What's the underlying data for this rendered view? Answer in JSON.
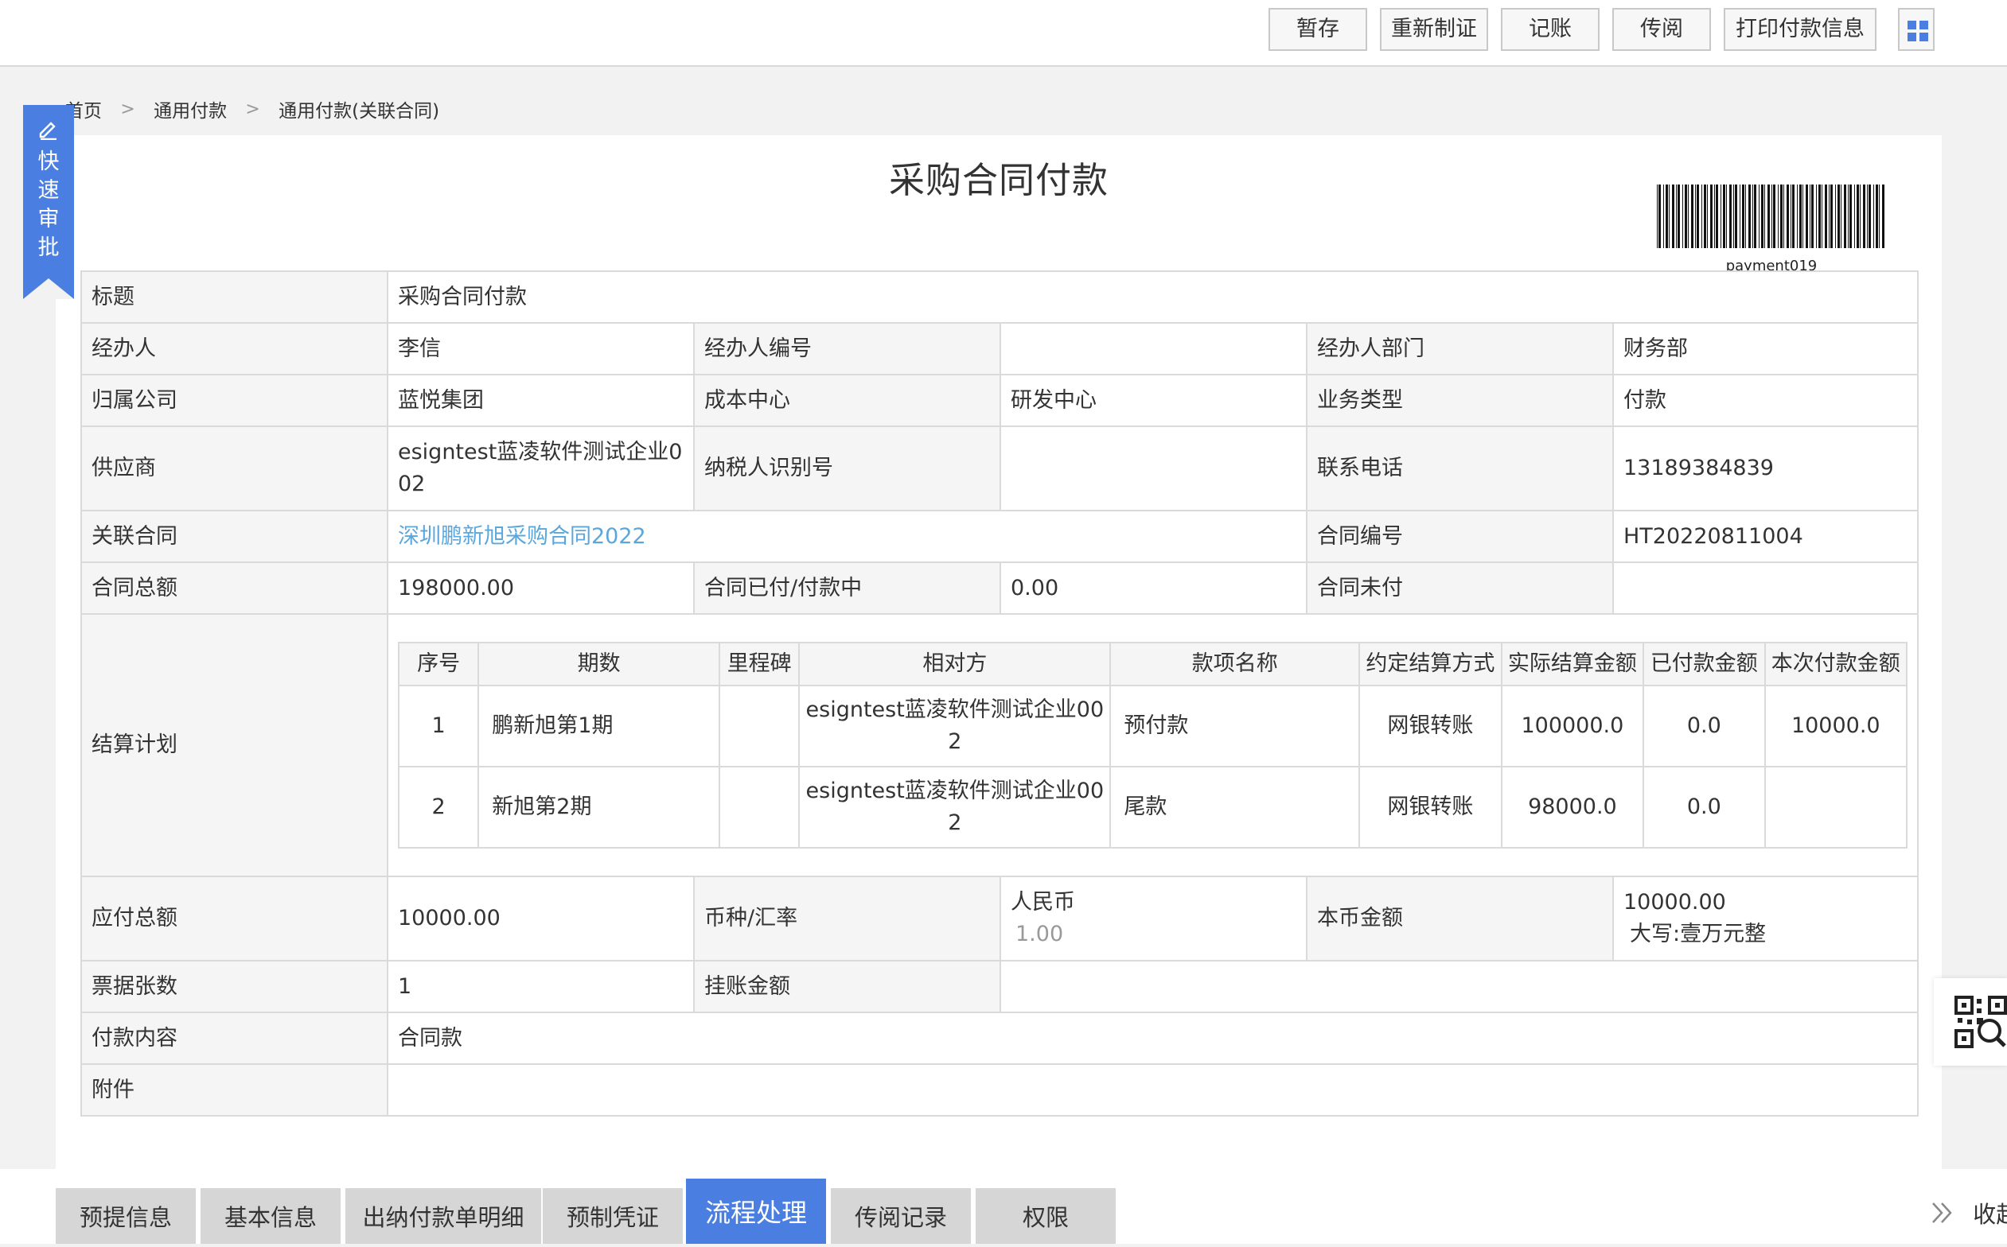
{
  "toolbar": {
    "buttons": [
      "暂存",
      "重新制证",
      "记账",
      "传阅",
      "打印付款信息"
    ],
    "grid_icon": "grid-icon"
  },
  "breadcrumb": [
    "首页",
    "通用付款",
    "通用付款(关联合同)"
  ],
  "quick_approve": {
    "label": "快速审批",
    "icon": "pencil-icon"
  },
  "document": {
    "title": "采购合同付款",
    "barcode_text": "payment019"
  },
  "form": {
    "title_label": "标题",
    "title_value": "采购合同付款",
    "handler_label": "经办人",
    "handler_value": "李信",
    "handler_no_label": "经办人编号",
    "handler_no_value": "",
    "handler_dept_label": "经办人部门",
    "handler_dept_value": "财务部",
    "company_label": "归属公司",
    "company_value": "蓝悦集团",
    "cost_center_label": "成本中心",
    "cost_center_value": "研发中心",
    "biz_type_label": "业务类型",
    "biz_type_value": "付款",
    "supplier_label": "供应商",
    "supplier_value": "esigntest蓝凌软件测试企业002",
    "tax_id_label": "纳税人识别号",
    "tax_id_value": "",
    "phone_label": "联系电话",
    "phone_value": "13189384839",
    "contract_label": "关联合同",
    "contract_value": "深圳鹏新旭采购合同2022",
    "contract_no_label": "合同编号",
    "contract_no_value": "HT20220811004",
    "contract_total_label": "合同总额",
    "contract_total_value": "198000.00",
    "contract_paid_label": "合同已付/付款中",
    "contract_paid_value": "0.00",
    "contract_unpaid_label": "合同未付",
    "contract_unpaid_value": "",
    "plan_label": "结算计划",
    "payable_label": "应付总额",
    "payable_value": "10000.00",
    "currency_label": "币种/汇率",
    "currency_value": "人民币",
    "rate_value": "1.00",
    "local_amount_label": "本币金额",
    "local_amount_value": "10000.00",
    "local_amount_upper": "大写:壹万元整",
    "bill_count_label": "票据张数",
    "bill_count_value": "1",
    "pending_amount_label": "挂账金额",
    "pending_amount_value": "",
    "content_label": "付款内容",
    "content_value": "合同款",
    "attachment_label": "附件",
    "attachment_value": ""
  },
  "plan_table": {
    "headers": [
      "序号",
      "期数",
      "里程碑",
      "相对方",
      "款项名称",
      "约定结算方式",
      "实际结算金额",
      "已付款金额",
      "本次付款金额"
    ],
    "rows": [
      {
        "no": "1",
        "period": "鹏新旭第1期",
        "milestone": "",
        "party": "esigntest蓝凌软件测试企业002",
        "item": "预付款",
        "method": "网银转账",
        "actual": "100000.0",
        "paid": "0.0",
        "current": "10000.0"
      },
      {
        "no": "2",
        "period": "新旭第2期",
        "milestone": "",
        "party": "esigntest蓝凌软件测试企业002",
        "item": "尾款",
        "method": "网银转账",
        "actual": "98000.0",
        "paid": "0.0",
        "current": ""
      }
    ]
  },
  "bottom_tabs": {
    "items": [
      "预提信息",
      "基本信息",
      "出纳付款单明细",
      "预制凭证",
      "流程处理",
      "传阅记录",
      "权限"
    ],
    "active": "流程处理",
    "collapse_label": "收起"
  },
  "colors": {
    "accent": "#4a7ee0",
    "link": "#5ba7dc",
    "label_bg": "#f5f5f5",
    "tab_bg": "#d6d6d6"
  }
}
